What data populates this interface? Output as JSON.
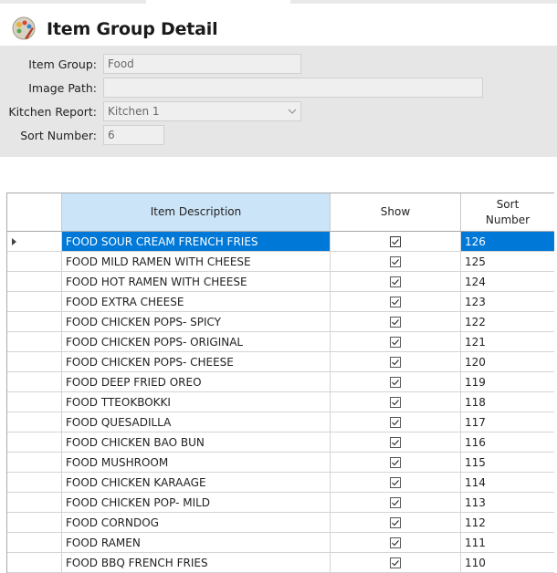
{
  "window": {
    "title": "Item Group Detail"
  },
  "form": {
    "item_group": {
      "label": "Item Group:",
      "value": "Food"
    },
    "image_path": {
      "label": "Image Path:",
      "value": ""
    },
    "kitchen_report": {
      "label": "Kitchen Report:",
      "value": "Kitchen 1"
    },
    "sort_number": {
      "label": "Sort Number:",
      "value": "6"
    }
  },
  "grid": {
    "columns": {
      "description": "Item Description",
      "show": "Show",
      "sort": "Sort Number"
    },
    "selected_row": 0,
    "rows": [
      {
        "description": "FOOD SOUR CREAM FRENCH FRIES",
        "show": true,
        "sort": "126"
      },
      {
        "description": "FOOD MILD RAMEN WITH CHEESE",
        "show": true,
        "sort": "125"
      },
      {
        "description": "FOOD HOT RAMEN WITH CHEESE",
        "show": true,
        "sort": "124"
      },
      {
        "description": "FOOD EXTRA CHEESE",
        "show": true,
        "sort": "123"
      },
      {
        "description": "FOOD CHICKEN POPS- SPICY",
        "show": true,
        "sort": "122"
      },
      {
        "description": "FOOD CHICKEN POPS- ORIGINAL",
        "show": true,
        "sort": "121"
      },
      {
        "description": "FOOD CHICKEN POPS- CHEESE",
        "show": true,
        "sort": "120"
      },
      {
        "description": "FOOD DEEP FRIED OREO",
        "show": true,
        "sort": "119"
      },
      {
        "description": "FOOD TTEOKBOKKI",
        "show": true,
        "sort": "118"
      },
      {
        "description": "FOOD QUESADILLA",
        "show": true,
        "sort": "117"
      },
      {
        "description": "FOOD CHICKEN BAO BUN",
        "show": true,
        "sort": "116"
      },
      {
        "description": "FOOD MUSHROOM",
        "show": true,
        "sort": "115"
      },
      {
        "description": "FOOD CHICKEN KARAAGE",
        "show": true,
        "sort": "114"
      },
      {
        "description": "FOOD CHICKEN POP- MILD",
        "show": true,
        "sort": "113"
      },
      {
        "description": "FOOD CORNDOG",
        "show": true,
        "sort": "112"
      },
      {
        "description": "FOOD RAMEN",
        "show": true,
        "sort": "111"
      },
      {
        "description": "FOOD BBQ FRENCH FRIES",
        "show": true,
        "sort": "110"
      }
    ]
  }
}
